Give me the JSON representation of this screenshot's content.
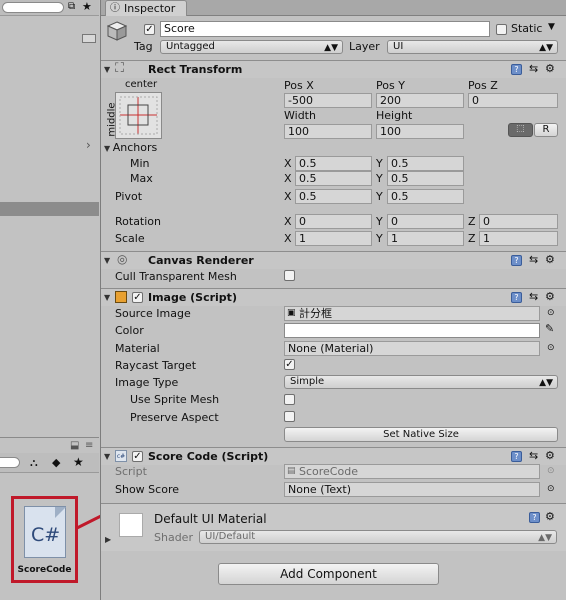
{
  "left_panel": {
    "asset": {
      "icon_text": "C#",
      "label": "ScoreCode"
    }
  },
  "inspector": {
    "tab_label": "Inspector",
    "object": {
      "active": true,
      "name": "Score",
      "static_label": "Static",
      "static": false,
      "tag_label": "Tag",
      "tag_value": "Untagged",
      "layer_label": "Layer",
      "layer_value": "UI"
    },
    "rect_transform": {
      "title": "Rect Transform",
      "anchor_top_label": "center",
      "anchor_side_label": "middle",
      "pos_x_label": "Pos X",
      "pos_x": "-500",
      "pos_y_label": "Pos Y",
      "pos_y": "200",
      "pos_z_label": "Pos Z",
      "pos_z": "0",
      "width_label": "Width",
      "width": "100",
      "height_label": "Height",
      "height": "100",
      "raw_btn": "R",
      "anchors_label": "Anchors",
      "min_label": "Min",
      "min_x": "0.5",
      "min_y": "0.5",
      "max_label": "Max",
      "max_x": "0.5",
      "max_y": "0.5",
      "pivot_label": "Pivot",
      "pivot_x": "0.5",
      "pivot_y": "0.5",
      "rotation_label": "Rotation",
      "rot_x": "0",
      "rot_y": "0",
      "rot_z": "0",
      "scale_label": "Scale",
      "scale_x": "1",
      "scale_y": "1",
      "scale_z": "1",
      "x": "X",
      "y": "Y",
      "z": "Z"
    },
    "canvas_renderer": {
      "title": "Canvas Renderer",
      "cull_label": "Cull Transparent Mesh",
      "cull": false
    },
    "image": {
      "title": "Image (Script)",
      "enabled": true,
      "source_label": "Source Image",
      "source_value": "計分框",
      "color_label": "Color",
      "material_label": "Material",
      "material_value": "None (Material)",
      "raycast_label": "Raycast Target",
      "raycast": true,
      "type_label": "Image Type",
      "type_value": "Simple",
      "sprite_mesh_label": "Use Sprite Mesh",
      "aspect_label": "Preserve Aspect",
      "native_btn": "Set Native Size"
    },
    "score_code": {
      "title": "Score Code (Script)",
      "enabled": true,
      "script_label": "Script",
      "script_value": "ScoreCode",
      "show_label": "Show Score",
      "show_value": "None (Text)"
    },
    "material": {
      "title": "Default UI Material",
      "shader_label": "Shader",
      "shader_value": "UI/Default"
    },
    "add_component": "Add Component"
  },
  "colors": {
    "arrow": "#c0192a",
    "asset_highlight": "#c0192a"
  }
}
